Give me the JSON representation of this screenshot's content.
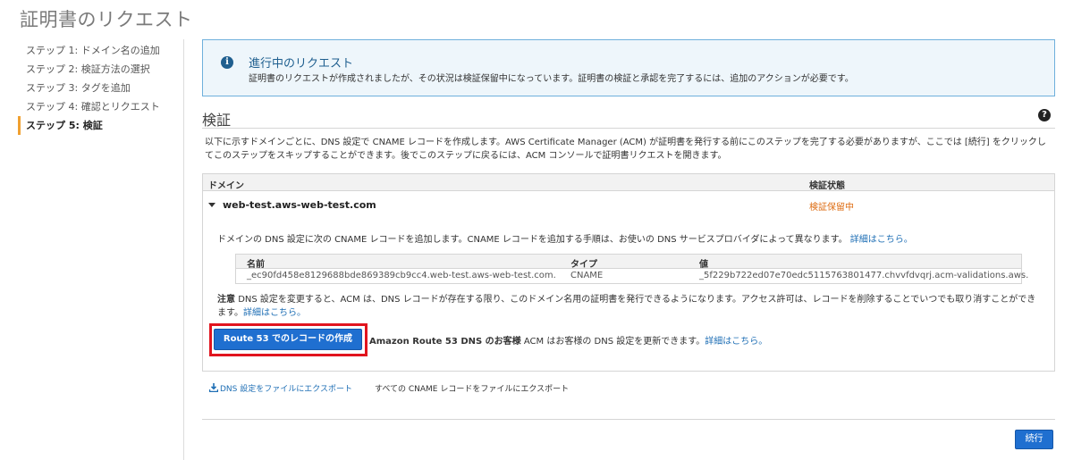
{
  "page_title": "証明書のリクエスト",
  "steps": [
    {
      "label": "ステップ 1: ドメイン名の追加",
      "active": false
    },
    {
      "label": "ステップ 2: 検証方法の選択",
      "active": false
    },
    {
      "label": "ステップ 3: タグを追加",
      "active": false
    },
    {
      "label": "ステップ 4: 確認とリクエスト",
      "active": false
    },
    {
      "label": "ステップ 5: 検証",
      "active": true
    }
  ],
  "info": {
    "icon": "info-icon",
    "title": "進行中のリクエスト",
    "text": "証明書のリクエストが作成されましたが、その状況は検証保留中になっています。証明書の検証と承認を完了するには、追加のアクションが必要です。"
  },
  "section": {
    "title": "検証",
    "description": "以下に示すドメインごとに、DNS 設定で CNAME レコードを作成します。AWS Certificate Manager (ACM) が証明書を発行する前にこのステップを完了する必要がありますが、ここでは [続行] をクリックしてこのステップをスキップすることができます。後でこのステップに戻るには、ACM コンソールで証明書リクエストを開きます。"
  },
  "domain_table": {
    "headers": {
      "domain": "ドメイン",
      "status": "検証状態"
    },
    "row": {
      "domain": "web-test.aws-web-test.com",
      "status": "検証保留中",
      "add_text": "ドメインの DNS 設定に次の CNAME レコードを追加します。CNAME レコードを追加する手順は、お使いの DNS サービスプロバイダによって異なります。",
      "add_link": "詳細はこちら。",
      "record_headers": {
        "name": "名前",
        "type": "タイプ",
        "value": "値"
      },
      "record": {
        "name": "_ec90fd458e8129688bde869389cb9cc4.web-test.aws-web-test.com.",
        "type": "CNAME",
        "value": "_5f229b722ed07e70edc5115763801477.chvvfdvqrj.acm-validations.aws."
      },
      "note_label": "注意",
      "note_text": "DNS 設定を変更すると、ACM は、DNS レコードが存在する限り、このドメイン名用の証明書を発行できるようになります。アクセス許可は、レコードを削除することでいつでも取り消すことができます。",
      "note_link": "詳細はこちら。",
      "route53_button": "Route 53 でのレコードの作成",
      "route53_label": "Amazon Route 53 DNS のお客様",
      "route53_text": "ACM はお客様の DNS 設定を更新できます。",
      "route53_link": "詳細はこちら。"
    }
  },
  "export": {
    "link": "DNS 設定をファイルにエクスポート",
    "description": "すべての CNAME レコードをファイルにエクスポート"
  },
  "continue_button": "続行",
  "colors": {
    "primary": "#1f6fd0",
    "pending": "#dd6b10",
    "highlight": "#e1141e",
    "link": "#1f6fb5"
  }
}
